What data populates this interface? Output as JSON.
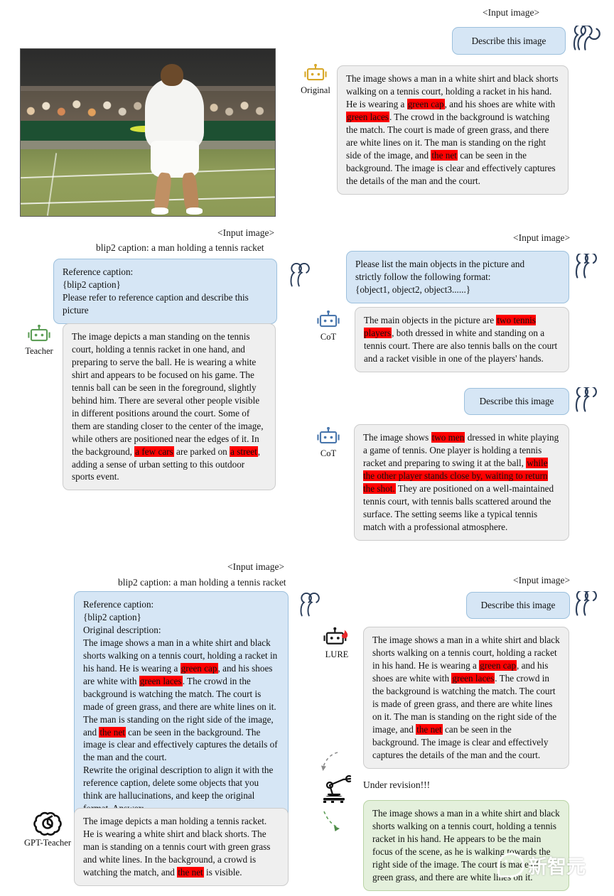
{
  "figure": {
    "input_image_label": "<Input image>",
    "blip2_caption_line": "blip2 caption: a man holding a tennis racket",
    "photo_alt": "tennis player in white holding racket with balls, crowd in background"
  },
  "panel_original": {
    "input_label": "<Input image>",
    "prompt": "Describe this image",
    "agent_name": "Original",
    "agent_icon": "robot-icon",
    "user_icon": "people-icon",
    "response": [
      {
        "t": "The image shows a man in a white shirt and black shorts walking on a tennis court, holding a racket in his hand. He is wearing a "
      },
      {
        "t": "green cap",
        "hl": true
      },
      {
        "t": ", and his shoes are white with "
      },
      {
        "t": "green laces",
        "hl": true
      },
      {
        "t": ". The crowd in the background is watching the match. The court is made of green grass, and there are white lines on it. The man is standing on the right side of the image, and "
      },
      {
        "t": "the net",
        "hl": true
      },
      {
        "t": " can be seen in the background. The image is clear and effectively captures the details of the man and the court."
      }
    ]
  },
  "panel_teacher": {
    "input_label": "<Input image>",
    "blip2_caption": "blip2 caption: a man holding a tennis racket",
    "agent_name": "Teacher",
    "agent_icon": "robot-icon",
    "user_icon": "people-icon",
    "prompt_lines": [
      "Reference caption:",
      "{blip2 caption}",
      "Please refer to reference caption and describe this",
      "picture"
    ],
    "response": [
      {
        "t": "The image depicts a man standing on the tennis court, holding a tennis racket in one hand, and preparing to serve the ball. He is wearing a white shirt and appears to be focused on his game. The tennis ball can be seen in the foreground, slightly behind him. There are several other people visible in different positions around the court. Some of them are standing closer to the center of the image, while others are positioned near the edges of it. In the background, "
      },
      {
        "t": "a few cars",
        "hl": true
      },
      {
        "t": " are parked on "
      },
      {
        "t": "a street",
        "hl": true
      },
      {
        "t": ", adding a sense of urban setting to this outdoor sports event."
      }
    ]
  },
  "panel_cot_objects": {
    "input_label": "<Input image>",
    "agent_name": "CoT",
    "agent_icon": "robot-icon",
    "user_icon": "people-icon",
    "prompt_lines": [
      "Please list the main objects in the picture and",
      "strictly follow the following format:",
      "{object1, object2, object3......}"
    ],
    "response": [
      {
        "t": "The main objects in the picture are "
      },
      {
        "t": "two tennis players",
        "hl": true
      },
      {
        "t": ", both dressed in white and standing on a tennis court. There are also tennis balls on the court and a racket visible in one of the players' hands."
      }
    ]
  },
  "panel_cot_describe": {
    "prompt": "Describe this image",
    "agent_name": "CoT",
    "agent_icon": "robot-icon",
    "user_icon": "people-icon",
    "response": [
      {
        "t": "The image shows "
      },
      {
        "t": "two men",
        "hl": true
      },
      {
        "t": " dressed in white playing a game of tennis. One player is holding a tennis racket and preparing to swing it at the ball, "
      },
      {
        "t": "while the other player stands close by, waiting to return the shot.",
        "hl": true
      },
      {
        "t": " They are positioned on a well-maintained tennis court, with tennis balls scattered around the surface. The setting seems like a typical tennis match with a professional atmosphere."
      }
    ]
  },
  "panel_gpt_teacher": {
    "input_label": "<Input image>",
    "blip2_caption": "blip2 caption: a man holding a tennis racket",
    "agent_name": "GPT-Teacher",
    "agent_icon": "openai-logo-icon",
    "user_icon": "people-icon",
    "prompt": [
      {
        "t": "Reference caption:\n{blip2 caption}\nOriginal description:\nThe image shows a man in a white shirt and black shorts walking on a tennis court, holding a racket in his hand. He is wearing a "
      },
      {
        "t": "green cap",
        "hl": true
      },
      {
        "t": ", and his shoes are white with "
      },
      {
        "t": "green laces",
        "hl": true
      },
      {
        "t": ". The crowd in the background is watching the match. The court is made of green grass, and there are white lines on it. The man is standing on the right side of the image, and "
      },
      {
        "t": "the net",
        "hl": true
      },
      {
        "t": " can be seen in the background. The image is clear and effectively captures the details of the man and the court.\nRewrite the original description to align it with the reference caption, delete some objects that you think are hallucinations, and keep the original format. Answer:"
      }
    ],
    "response": [
      {
        "t": "The image depicts a man holding a tennis racket. He is wearing a white shirt and black shorts. The man is standing on a tennis court with green grass and white lines. In the background, a crowd is watching the match, and "
      },
      {
        "t": "the net",
        "hl": true
      },
      {
        "t": " is visible."
      }
    ]
  },
  "panel_lure": {
    "input_label": "<Input image>",
    "prompt": "Describe this image",
    "agent_name": "LURE",
    "agent_icon": "robot-flame-icon",
    "user_icon": "people-icon",
    "response": [
      {
        "t": "The image shows a man in a white shirt and black shorts walking on a tennis court, holding a racket in his hand. He is wearing a "
      },
      {
        "t": "green cap",
        "hl": true
      },
      {
        "t": ", and his shoes are white with "
      },
      {
        "t": "green laces",
        "hl": true
      },
      {
        "t": ". The crowd in the background is watching the match. The court is made of green grass, and there are white lines on it. The man is standing on the right side of the image, and "
      },
      {
        "t": "the net",
        "hl": true
      },
      {
        "t": " can be seen in the background. The image is clear and effectively captures the details of the man and the court."
      }
    ],
    "revision_label": "Under revision!!!",
    "revision_icon": "robot-arm-icon",
    "revised_response": [
      {
        "t": "The image shows a man in a white shirt and black shorts walking on a tennis court, holding a tennis racket in his hand. He appears to be the main focus of the scene, as he is walking towards the right side of the image. The court is made of green grass, and there are white lines on it."
      }
    ]
  },
  "watermark": {
    "text": "新智元",
    "logo": "speech-bubble-icon"
  },
  "colors": {
    "highlight": "#fe0000",
    "user_bubble": "#d6e6f5",
    "user_bubble_border": "#9cc0dd",
    "bot_bubble": "#efefef",
    "bot_bubble_border": "#cccccc",
    "revised_bubble": "#e4f0dc",
    "revised_bubble_border": "#b9d3a5",
    "original_icon": "#d8a82a",
    "teacher_icon": "#5d9e57",
    "cot_icon": "#4a77ad",
    "lure_icon": "#1a1a1a",
    "people_icon": "#2c3e5a"
  }
}
